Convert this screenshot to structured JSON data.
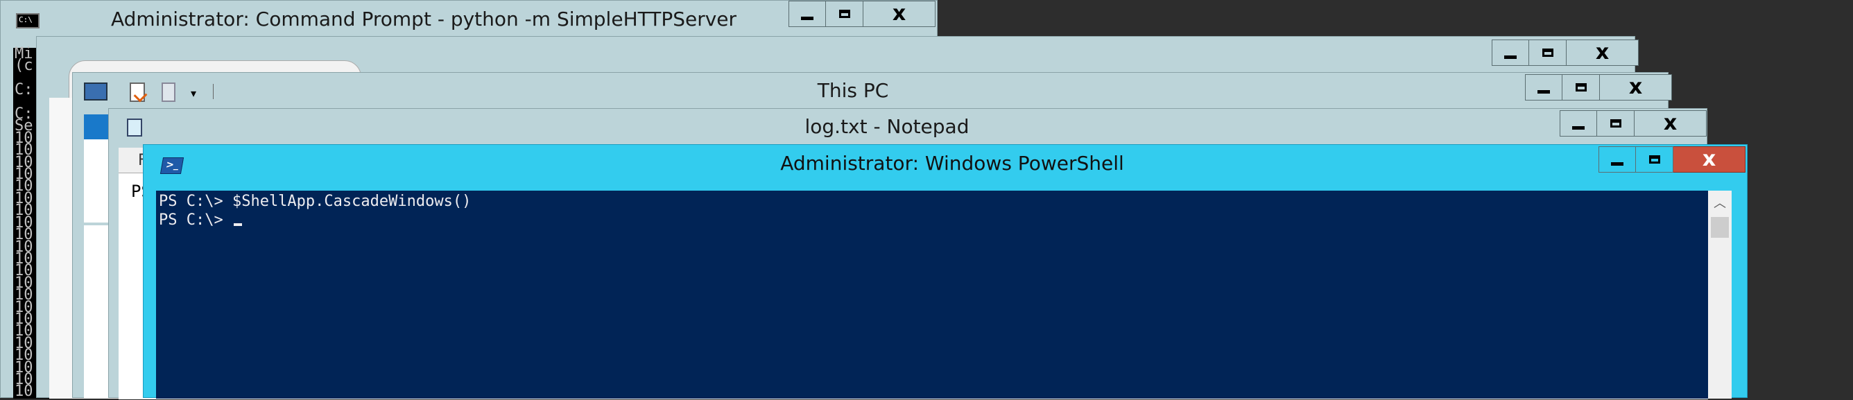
{
  "windows": {
    "cmd": {
      "title": "Administrator: Command Prompt - python  -m SimpleHTTPServer",
      "side_text": [
        "Mi",
        "(c",
        "",
        "C:",
        "",
        "C:",
        "Se",
        "10",
        "10",
        "10",
        "10",
        "10",
        "10",
        "10",
        "10",
        "10",
        "10",
        "10",
        "10",
        "10",
        "10",
        "10",
        "10",
        "10",
        "10",
        "10",
        "10",
        "10",
        "10"
      ]
    },
    "back_window": {
      "title": ""
    },
    "explorer": {
      "title": "This PC",
      "file_tab_stub": "Fil"
    },
    "notepad": {
      "title": "log.txt - Notepad",
      "content_stub": "PS"
    },
    "powershell": {
      "title": "Administrator: Windows PowerShell",
      "lines": [
        "PS C:\\> $ShellApp.CascadeWindows()",
        "PS C:\\> "
      ]
    }
  },
  "colors": {
    "desktop": "#2d2d2d",
    "inactive_frame": "#bcd4d9",
    "active_frame": "#33ccee",
    "ps_background": "#012456",
    "ps_text": "#eeedf0",
    "close_active": "#c9503d"
  },
  "icons": {
    "cmd": "cmd-icon",
    "explorer": "this-pc-icon",
    "notepad": "notepad-icon",
    "powershell": "powershell-icon",
    "minimize": "minimize-icon",
    "maximize": "maximize-icon",
    "close": "close-icon"
  }
}
